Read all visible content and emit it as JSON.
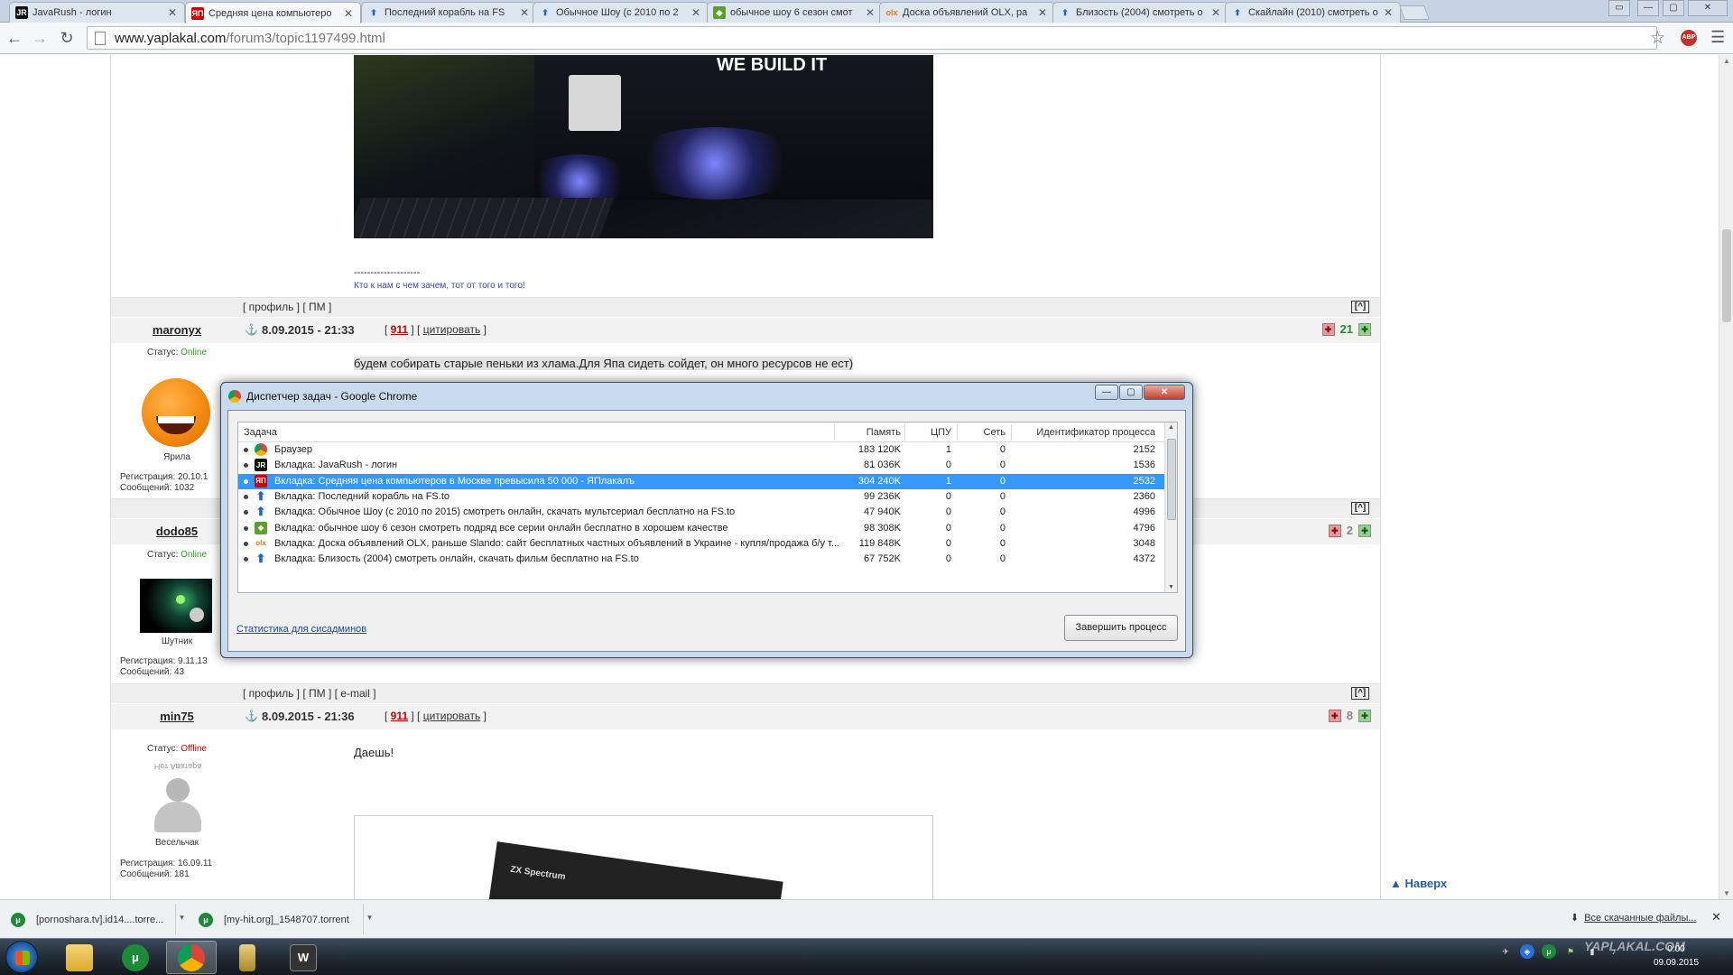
{
  "browser": {
    "tabs": [
      {
        "title": "JavaRush - логин",
        "favicon": "JR",
        "active": false
      },
      {
        "title": "Средняя цена компьютеро",
        "favicon": "ЯП",
        "active": true
      },
      {
        "title": "Последний корабль на FS",
        "favicon": "fs-arrow-icon",
        "active": false
      },
      {
        "title": "Обычное Шоу (с 2010 по 2",
        "favicon": "fs-arrow-icon",
        "active": false
      },
      {
        "title": "обычное шоу 6 сезон смот",
        "favicon": "show-icon",
        "active": false
      },
      {
        "title": "Доска объявлений OLX, ра",
        "favicon": "olx",
        "active": false
      },
      {
        "title": "Близость (2004) смотреть о",
        "favicon": "fs-arrow-icon",
        "active": false
      },
      {
        "title": "Скайлайн (2010) смотреть о",
        "favicon": "fs-arrow-icon",
        "active": false
      }
    ],
    "url_host": "www.yaplakal.com",
    "url_path": "/forum3/topic1197499.html",
    "abp_badge": "ABP"
  },
  "forum": {
    "image_badge": "WE BUILD IT",
    "sig_dashes": "--------------------",
    "sig_text": "Кто к нам с чем зачем, тот от того и того!",
    "bar_links_1": "[ профиль ] [ ПМ ]",
    "bar_links_2": "[ профиль ] [ ПМ ] [ e-mail ]",
    "up_button": "[^]",
    "posts": [
      {
        "username": "maronyx",
        "status_label": "Статус:",
        "status": "Online",
        "rank": "Ярила",
        "reg": "Регистрация: 20.10.1",
        "messages": "Сообщений: 1032",
        "date": "8.09.2015 - 21:33",
        "num": "911",
        "quote": "цитировать",
        "rating": "21",
        "text": "будем собирать старые пеньки из хлама.Для Япа сидеть сойдет, он много ресурсов не ест)"
      },
      {
        "username": "dodo85",
        "status_label": "Статус:",
        "status": "Online",
        "rank": "Шутник",
        "reg": "Регистрация: 9.11.13",
        "messages": "Сообщений: 43",
        "rating": "2"
      },
      {
        "username": "min75",
        "status_label": "Статус:",
        "status": "Offline",
        "rank": "Весельчак",
        "avatar_caption": "Нет Аватара",
        "reg": "Регистрация: 16.09.11",
        "messages": "Сообщений: 181",
        "date": "8.09.2015 - 21:36",
        "num": "911",
        "quote": "цитировать",
        "rating": "8",
        "text": "Даешь!",
        "image_label": "ZX Spectrum"
      }
    ],
    "back_to_top": "▲ Наверх"
  },
  "task_manager": {
    "title": "Диспетчер задач - Google Chrome",
    "columns": {
      "task": "Задача",
      "memory": "Память",
      "cpu": "ЦПУ",
      "network": "Сеть",
      "pid": "Идентификатор процесса"
    },
    "rows": [
      {
        "task": "Браузер",
        "icon": "chrome-icon",
        "memory": "183 120K",
        "cpu": "1",
        "network": "0",
        "pid": "2152",
        "selected": false
      },
      {
        "task": "Вкладка: JavaRush - логин",
        "icon": "JR",
        "memory": "81 036K",
        "cpu": "0",
        "network": "0",
        "pid": "1536",
        "selected": false
      },
      {
        "task": "Вкладка: Средняя цена компьютеров в Москве превысила 50 000 - ЯПлакалъ",
        "icon": "ЯП",
        "memory": "304 240K",
        "cpu": "1",
        "network": "0",
        "pid": "2532",
        "selected": true
      },
      {
        "task": "Вкладка: Последний корабль на FS.to",
        "icon": "fs-arrow-icon",
        "memory": "99 236K",
        "cpu": "0",
        "network": "0",
        "pid": "2360",
        "selected": false
      },
      {
        "task": "Вкладка: Обычное Шоу (с 2010 по 2015) смотреть онлайн, скачать мультсериал бесплатно на FS.to",
        "icon": "fs-arrow-icon",
        "memory": "47 940K",
        "cpu": "0",
        "network": "0",
        "pid": "4996",
        "selected": false
      },
      {
        "task": "Вкладка: обычное шоу 6 сезон смотреть подряд все серии онлайн бесплатно в хорошем качестве",
        "icon": "show-icon",
        "memory": "98 308K",
        "cpu": "0",
        "network": "0",
        "pid": "4796",
        "selected": false
      },
      {
        "task": "Вкладка: Доска объявлений OLX, раньше Slando: сайт бесплатных частных объявлений в Украине - купля/продажа б/у т...",
        "icon": "olx",
        "memory": "119 848K",
        "cpu": "0",
        "network": "0",
        "pid": "3048",
        "selected": false
      },
      {
        "task": "Вкладка: Близость (2004) смотреть онлайн, скачать фильм бесплатно на FS.to",
        "icon": "fs-arrow-icon",
        "memory": "67 752K",
        "cpu": "0",
        "network": "0",
        "pid": "4372",
        "selected": false
      }
    ],
    "stats_link": "Статистика для сисадминов",
    "end_process": "Завершить процесс"
  },
  "downloads": {
    "items": [
      "[pornoshara.tv].id14....torre...",
      "[my-hit.org]_1548707.torrent"
    ],
    "all_downloads": "Все скачанные файлы..."
  },
  "taskbar": {
    "time": "0:00",
    "date": "09.09.2015",
    "watermark": "YAPLAKAL.COM"
  },
  "colors": {
    "selection": "#3399ff",
    "online": "#2a9a2a",
    "offline": "#cc0000",
    "rating": "#2a8a2a",
    "link_red": "#cc0000"
  }
}
